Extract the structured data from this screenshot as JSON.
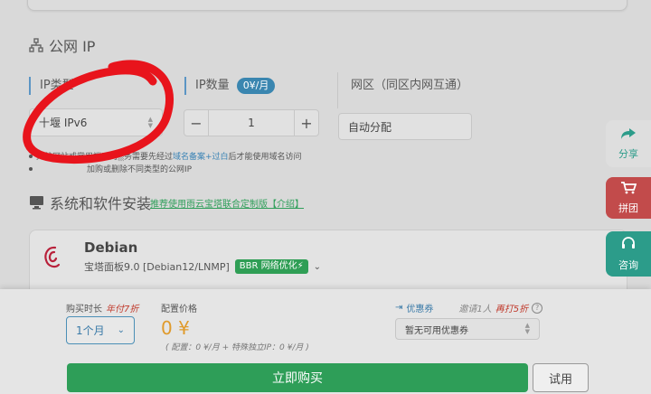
{
  "public_ip": {
    "title": "公网 IP",
    "ip_type_label": "IP类型",
    "ip_type_value": "十堰 IPv6",
    "ip_count_label": "IP数量",
    "ip_count_price": "0¥/月",
    "ip_count_value": "1",
    "minus_label": "−",
    "plus_label": "+",
    "zone_label": "网区（同区内网互通）",
    "zone_value": "自动分配",
    "note1_prefix": "大陆网站或常用端口的",
    "note1_middle": "务需要先经过",
    "note1_link1": "域名备案",
    "note1_plus": "+",
    "note1_link2": "过白",
    "note1_suffix": "后才能使用域名访问",
    "note2": "加购或删除不同类型的公网IP"
  },
  "system": {
    "title": "系统和软件安装",
    "promo": "推荐使用雨云宝塔联合定制版【介绍】",
    "os_name": "Debian",
    "os_detail": "宝塔面板9.0 [Debian12/LNMP]",
    "bbr_badge": "BBR 网络优化⚡"
  },
  "side_tabs": {
    "share": "分享",
    "group": "拼团",
    "consult": "咨询"
  },
  "purchase": {
    "duration_label": "购买时长",
    "duration_promo": "年付7折",
    "duration_value": "1个月",
    "config_price_label": "配置价格",
    "price": "0 ¥",
    "price_note": "( 配置：0 ¥/月 + 特殊独立IP：0 ¥/月 )",
    "coupon_label": "优惠券",
    "invite_text": "邀请1人",
    "invite_promo": "再打5折",
    "coupon_value": "暂无可用优惠券",
    "buy_button": "立即购买",
    "trial_button": "试用"
  },
  "colors": {
    "accent_blue": "#3a86b0",
    "buy_green": "#2e9e58",
    "side_green": "#2c9c8a",
    "side_red": "#c24b4b",
    "price_orange": "#e09a2b",
    "annotation_red": "#e8141c"
  }
}
